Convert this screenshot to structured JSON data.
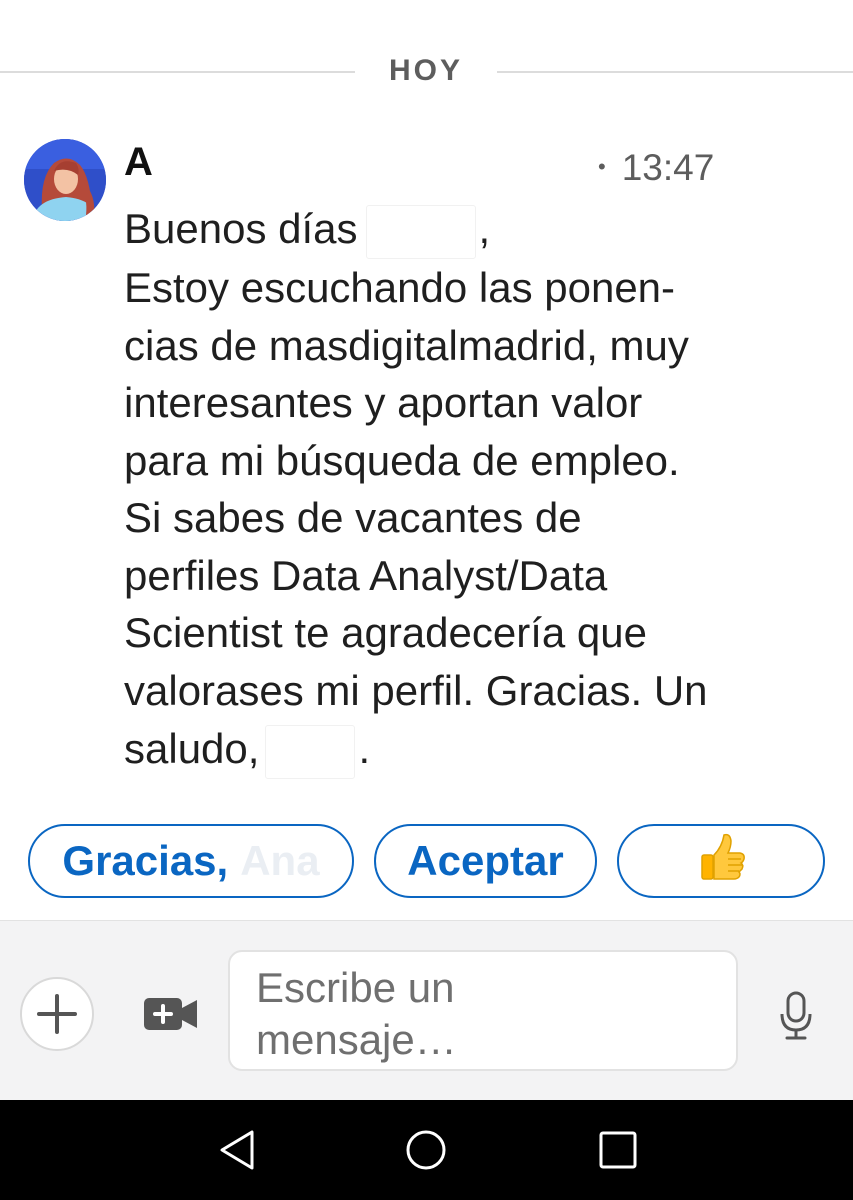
{
  "date_divider": {
    "label": "HOY"
  },
  "message": {
    "sender": "A",
    "time": "13:47",
    "lines": {
      "l1_greeting": "Buenos días",
      "l1_comma": ",",
      "l2": "Estoy escuchando las ponen-",
      "l3": "cias de masdigitalmadrid, muy",
      "l4": "interesantes y aportan valor",
      "l5": "para mi búsqueda de empleo.",
      "l6": "Si sabes de vacantes de",
      "l7": "perfiles Data Analyst/Data",
      "l8": "Scientist te agradecería que",
      "l9": "valorases mi perfil. Gracias. Un",
      "l10_start": "saludo,",
      "l10_end": "."
    }
  },
  "quick_replies": {
    "reply1": "Gracias,",
    "reply1_name": "Ana",
    "reply2": "Aceptar",
    "reply3": "👍"
  },
  "composer": {
    "placeholder_line1": "Escribe un",
    "placeholder_line2": "mensaje…"
  },
  "icons": {
    "add": "plus-icon",
    "video": "video-plus-icon",
    "mic": "microphone-icon",
    "back": "triangle-back-icon",
    "home": "circle-home-icon",
    "recents": "square-recents-icon"
  },
  "colors": {
    "accent": "#0a66c2",
    "avatar_bg": "#2f4fc9",
    "divider": "#dcdcdc",
    "composer_bg": "#f3f3f4",
    "navbar_bg": "#000000"
  }
}
